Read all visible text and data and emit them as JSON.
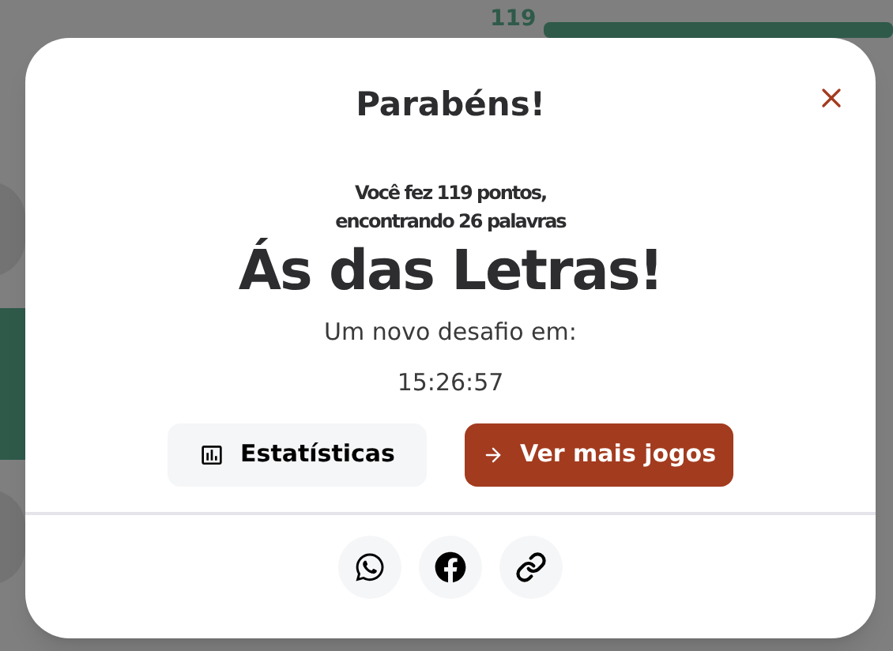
{
  "background": {
    "score": "119",
    "progress": {
      "level": 1
    }
  },
  "modal": {
    "title": "Parabéns!",
    "summary_lines": [
      "Você fez 119 pontos,",
      "encontrando 26 palavras"
    ],
    "rank": "Ás das Letras!",
    "next_label": "Um novo desafio em:",
    "countdown": "15:26:57",
    "buttons": [
      {
        "kind": "stats",
        "label": "Estatísticas"
      },
      {
        "kind": "more",
        "label": "Ver mais jogos"
      }
    ],
    "share": [
      {
        "kind": "whatsapp"
      },
      {
        "kind": "facebook"
      },
      {
        "kind": "link"
      }
    ]
  }
}
